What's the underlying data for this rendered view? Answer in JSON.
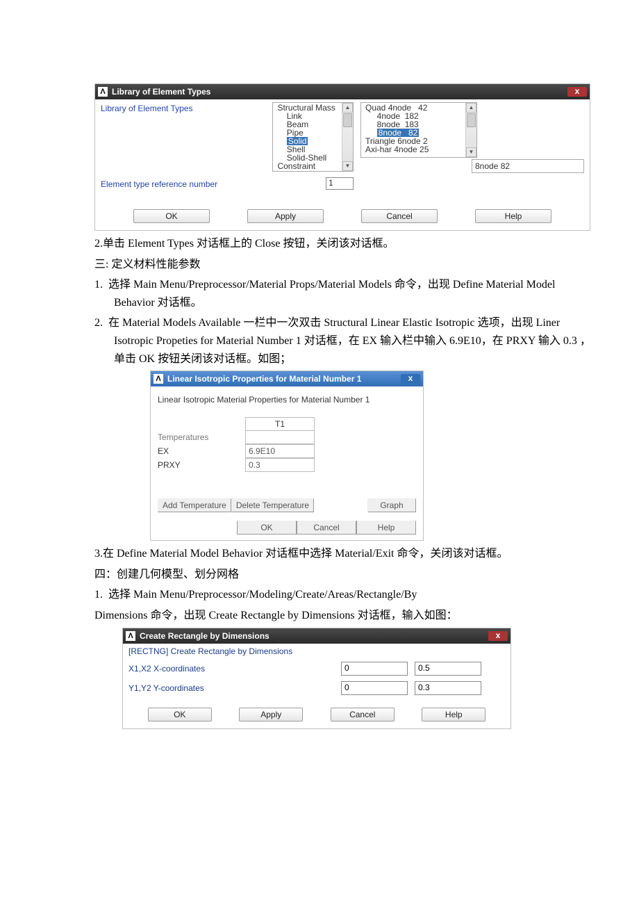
{
  "d1": {
    "title": "Library of Element Types",
    "label": "Library of Element Types",
    "list1": {
      "items": [
        "Structural Mass",
        "Link",
        "Beam",
        "Pipe",
        "Solid",
        "Shell",
        "Solid-Shell",
        "Constraint"
      ],
      "selected_index": 4
    },
    "list2": {
      "items": [
        "Quad 4node   42",
        "4node  182",
        "8node  183",
        "8node   82",
        "Triangle 6node 2",
        "Axi-har 4node 25"
      ],
      "selected_index": 3
    },
    "selected_detail": "8node   82",
    "ref_label": "Element type reference number",
    "ref_value": "1",
    "buttons": {
      "ok": "OK",
      "apply": "Apply",
      "cancel": "Cancel",
      "help": "Help"
    }
  },
  "t1": "2.单击 Element Types 对话框上的 Close 按钮，关闭该对话框。",
  "t2": "三: 定义材料性能参数",
  "t3_li": "1.",
  "t3": "选择 Main Menu/Preprocessor/Material Props/Material Models 命令，出现 Define Material Model Behavior 对话框。",
  "t4_li": "2.",
  "t4": "在 Material Models Available  一栏中一次双击 Structural Linear Elastic Isotropic 选项，出现 Liner Isotropic Propeties for Material Number 1 对话框，在 EX 输入栏中输入 6.9E10，在 PRXY 输入 0.3 ，单击 OK 按钮关闭该对话框。如图；",
  "d2": {
    "title": "Linear Isotropic Properties for Material Number 1",
    "heading": "Linear Isotropic Material Properties for Material Number 1",
    "col": "T1",
    "rows": {
      "temperatures": "Temperatures",
      "ex": "EX",
      "ex_val": "6.9E10",
      "prxy": "PRXY",
      "prxy_val": "0.3"
    },
    "buttons": {
      "add": "Add Temperature",
      "del": "Delete Temperature",
      "graph": "Graph",
      "ok": "OK",
      "cancel": "Cancel",
      "help": "Help"
    }
  },
  "t5": "3.在 Define Material Model Behavior 对话框中选择 Material/Exit 命令，关闭该对话框。",
  "t6": "四：创建几何模型、划分网格",
  "t7_li": "1.",
  "t7": "选择 Main Menu/Preprocessor/Modeling/Create/Areas/Rectangle/By",
  "t8": "Dimensions 命令，出现 Create Rectangle by Dimensions 对话框，输入如图：",
  "d3": {
    "title": "Create Rectangle by Dimensions",
    "subtitle": "[RECTNG]  Create Rectangle by Dimensions",
    "row1_label": "X1,X2  X-coordinates",
    "row1_v1": "0",
    "row1_v2": "0.5",
    "row2_label": "Y1,Y2  Y-coordinates",
    "row2_v1": "0",
    "row2_v2": "0.3",
    "buttons": {
      "ok": "OK",
      "apply": "Apply",
      "cancel": "Cancel",
      "help": "Help"
    }
  }
}
